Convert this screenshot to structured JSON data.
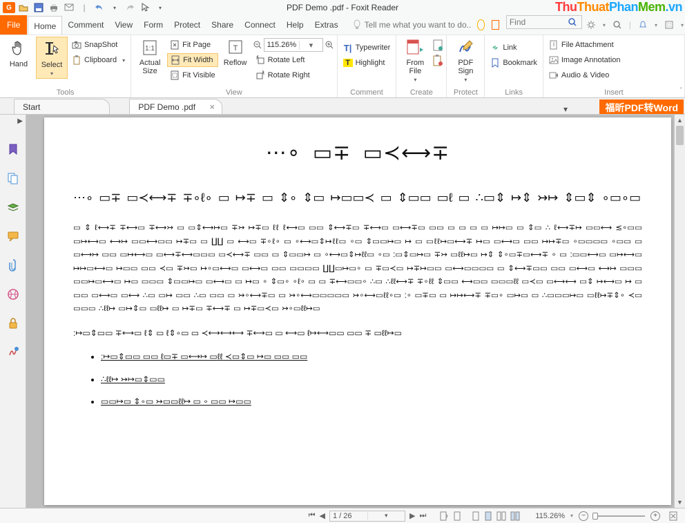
{
  "app": {
    "title": "PDF Demo .pdf - Foxit Reader",
    "brand_initial": "G"
  },
  "watermark": {
    "t1": "Thu",
    "t2": "Thuat",
    "t3": "Phan",
    "t4": "Mem",
    "ext": ".vn"
  },
  "menu": {
    "file": "File",
    "items": [
      "Home",
      "Comment",
      "View",
      "Form",
      "Protect",
      "Share",
      "Connect",
      "Help",
      "Extras"
    ],
    "active_index": 0,
    "tell_me_placeholder": "Tell me what you want to do...",
    "find_placeholder": "Find"
  },
  "ribbon": {
    "tools": {
      "label": "Tools",
      "hand": "Hand",
      "select": "Select",
      "snapshot": "SnapShot",
      "clipboard": "Clipboard"
    },
    "view": {
      "label": "View",
      "actual_size": "Actual\nSize",
      "fit_page": "Fit Page",
      "fit_width": "Fit Width",
      "fit_visible": "Fit Visible",
      "reflow": "Reflow",
      "rotate_left": "Rotate Left",
      "rotate_right": "Rotate Right",
      "zoom_value": "115.26%",
      "zoom_out": "−",
      "zoom_in": "+"
    },
    "comment": {
      "label": "Comment",
      "typewriter": "Typewriter",
      "highlight": "Highlight"
    },
    "create": {
      "label": "Create",
      "from_file": "From\nFile"
    },
    "protect": {
      "label": "Protect",
      "pdf_sign": "PDF\nSign"
    },
    "links": {
      "label": "Links",
      "link": "Link",
      "bookmark": "Bookmark"
    },
    "insert": {
      "label": "Insert",
      "file_attachment": "File Attachment",
      "image_annotation": "Image Annotation",
      "audio_video": "Audio & Video"
    }
  },
  "tabs": {
    "start": "Start",
    "doc": "PDF Demo .pdf",
    "pdf_to_word": "福昕PDF转Word"
  },
  "document": {
    "heading": "⋯∘ ▭∓ ▭≺⟷∓",
    "p1": "⋯∘ ▭∓ ▭≺⟷∓  ∓∘ℓ∘  ▭  ↦∓ ▭  ⇕∘ ⇕▭  ↦▭▭≺ ▭ ⇕▭▭ ▭ℓ ▭  ∴▭⇕ ↦⇕ ↣↦ ⇕▭⇕  ∘▭∘▭",
    "body1": "▭ ⇕ ℓ⟷∓ ∓⟷▭  ∓⟷↣ ▭  ▭⇕⟷↦▭  ∓↣  ↦∓▭  ℓℓ ℓ⟷▭  ▭▭ ⇕⟷∓▭  ∓⟷▭ ▭⟷∓▭ ▭▭ ▭ ▭  ▭  ▭  ↦↦▭  ▭ ⇕▭ ∴ ℓ⟷∓↦ ▭▭⟷  ≲∘▭▭  ▭↦⟷▭  ⟷↦ ▭▭⟷▭▭  ↦∓▭ ▭  ∐∐ ▭  ⟷▭ ∓∘ℓ∘ ▭  ∘⟷▭⇕↦ℓℓ▭ ∘▭  ⇕▭▭↦▭  ↦ ▭ ▭ℓℓ↦▭⟷∓ ↦▭ ▭⟷▭ ▭▭  ↦↦∓▭  ∘▭▭▭▭ ∘▭▭  ▭ ▭⟷↦ ▭▭  ▭↦⟷▭ ▭⟷∓⟷▭▭▭ ▭≺⟷∓ ▭▭ ▭  ⇕▭▭↦ ▭  ∘⟷▭⇕↦ℓℓ▭ ∘▭  :▭⇕▭↦▭  ∓↣ ▭ℓℓ↦▭ ↦⇕ ⇕∘▭∓▭⟷∓ ∘ ▭  :▭▭⟷▭  ▭↦⟷▭  ↦↦▭⟷▭  ↦▭▭  ▭▭ ≺▭ ∓↣▭  ↦∘▭⟷▭  ▭⟷▭  ▭▭ ▭▭▭▭  ∐∐▭↦▭∘ ▭  ∓▭≺▭ ↦∓↦▭▭ ▭⟷▭▭▭▭ ▭ ⇕⟷∓▭▭ ▭▭ ▭⟷▭  ⟷↦ ▭▭▭  ▭▭↦▭⟷▭  ↦▭ ▭▭▭  ⇕▭▭↦▭  ▭⟷▭  ▭ ↦▭ ∘ ⇕▭∘ ∘ℓ∘ ▭  ▭  ∓⟷▭▭∘ ∴▭ ∴ℓℓ⟷∓ ∓∘ℓℓ  ⇕▭▭ ⟷▭▭ ▭▭▭ℓℓ  ▭≺▭  ▭⟷⟷ ▭⇕ ↦⟷▭  ↦ ▭ ▭▭  ▭⟷▭  ▭⟷  ∴▭ ▭↦ ▭▭ ∴▭ ▭▭ ▭ ↣∘⟷∓▭  ▭ ↣∘⟷▭▭▭▭▭  ↣∘⟷▭ℓℓ∘▭ :∘ ▭∓▭ ▭ ↦↦⟷∓  ∓▭∘ ▭↦▭  ▭  ∴▭▭▭↦▭  ▭ℓℓ↦∓⇕∘ ≺▭  ▭▭▭  ∴ℓℓ↦ ▭↦⇕▭  ▭ℓℓ↦ ▭  ↦∓▭  ∓⟷∓ ▭  ↦∓▭≺▭  ↣∘▭ℓℓ↦▭",
    "body2": ":↦▭⇕▭▭  ∓⟷▭  ℓ⇕ ▭  ℓ⇕∘▭ ▭  ≺⟷⟷⟷ ∓⟷▭ ▭  ⟷▭  ℓ↦⟷▭▭  ▭▭  ∓ ▭ℓℓ↦▭",
    "li1": ":↦▭⇕▭▭  ▭▭ ℓ▭∓ ▭⟷↦ ▭ℓℓ  ≺▭⇕▭ ↦▭  ▭▭ ▭▭",
    "li2": "∴ℓℓ↦ ↣↦▭⇕▭▭",
    "li3": "▭▭↦▭ ⇕∘▭ ↣▭▭ℓℓ↦ ▭ ∘  ▭▭  ↦▭▭"
  },
  "status": {
    "page_display": "1 / 26",
    "zoom_display": "115.26%"
  }
}
